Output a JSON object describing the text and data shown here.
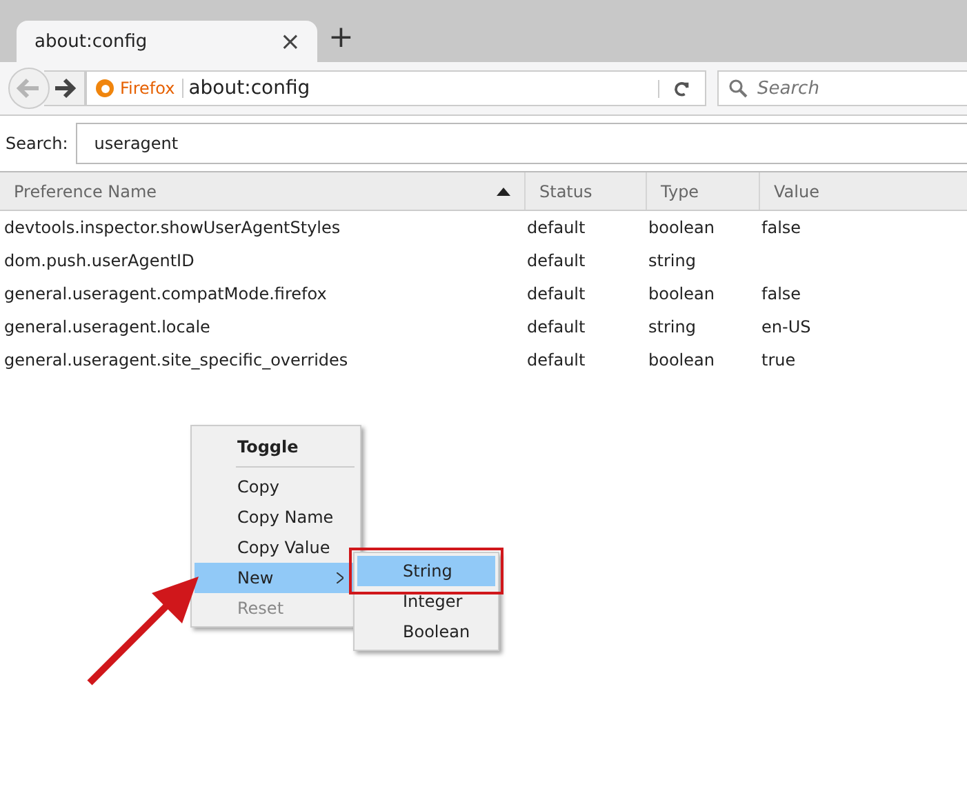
{
  "tab": {
    "title": "about:config",
    "close": "×",
    "new": "+"
  },
  "nav": {
    "identity": "Firefox",
    "url": "about:config",
    "search_placeholder": "Search"
  },
  "filter": {
    "label": "Search:",
    "value": "useragent"
  },
  "table": {
    "columns": [
      {
        "label": "Preference Name",
        "sorted": true
      },
      {
        "label": "Status",
        "sorted": false
      },
      {
        "label": "Type",
        "sorted": false
      },
      {
        "label": "Value",
        "sorted": false
      }
    ],
    "rows": [
      [
        "devtools.inspector.showUserAgentStyles",
        "default",
        "boolean",
        "false"
      ],
      [
        "dom.push.userAgentID",
        "default",
        "string",
        ""
      ],
      [
        "general.useragent.compatMode.firefox",
        "default",
        "boolean",
        "false"
      ],
      [
        "general.useragent.locale",
        "default",
        "string",
        "en-US"
      ],
      [
        "general.useragent.site_specific_overrides",
        "default",
        "boolean",
        "true"
      ]
    ]
  },
  "context_menu": {
    "items": [
      {
        "kind": "item",
        "label": "Toggle",
        "bold": true,
        "selected": false,
        "disabled": false,
        "submenu": false
      },
      {
        "kind": "separator"
      },
      {
        "kind": "item",
        "label": "Copy",
        "bold": false,
        "selected": false,
        "disabled": false,
        "submenu": false
      },
      {
        "kind": "item",
        "label": "Copy Name",
        "bold": false,
        "selected": false,
        "disabled": false,
        "submenu": false
      },
      {
        "kind": "item",
        "label": "Copy Value",
        "bold": false,
        "selected": false,
        "disabled": false,
        "submenu": false
      },
      {
        "kind": "item",
        "label": "New",
        "bold": false,
        "selected": true,
        "disabled": false,
        "submenu": true
      },
      {
        "kind": "item",
        "label": "Reset",
        "bold": false,
        "selected": false,
        "disabled": true,
        "submenu": false
      }
    ]
  },
  "submenu": {
    "items": [
      {
        "label": "String",
        "selected": true,
        "highlighted": true
      },
      {
        "label": "Integer",
        "selected": false,
        "highlighted": false
      },
      {
        "label": "Boolean",
        "selected": false,
        "highlighted": false
      }
    ]
  }
}
